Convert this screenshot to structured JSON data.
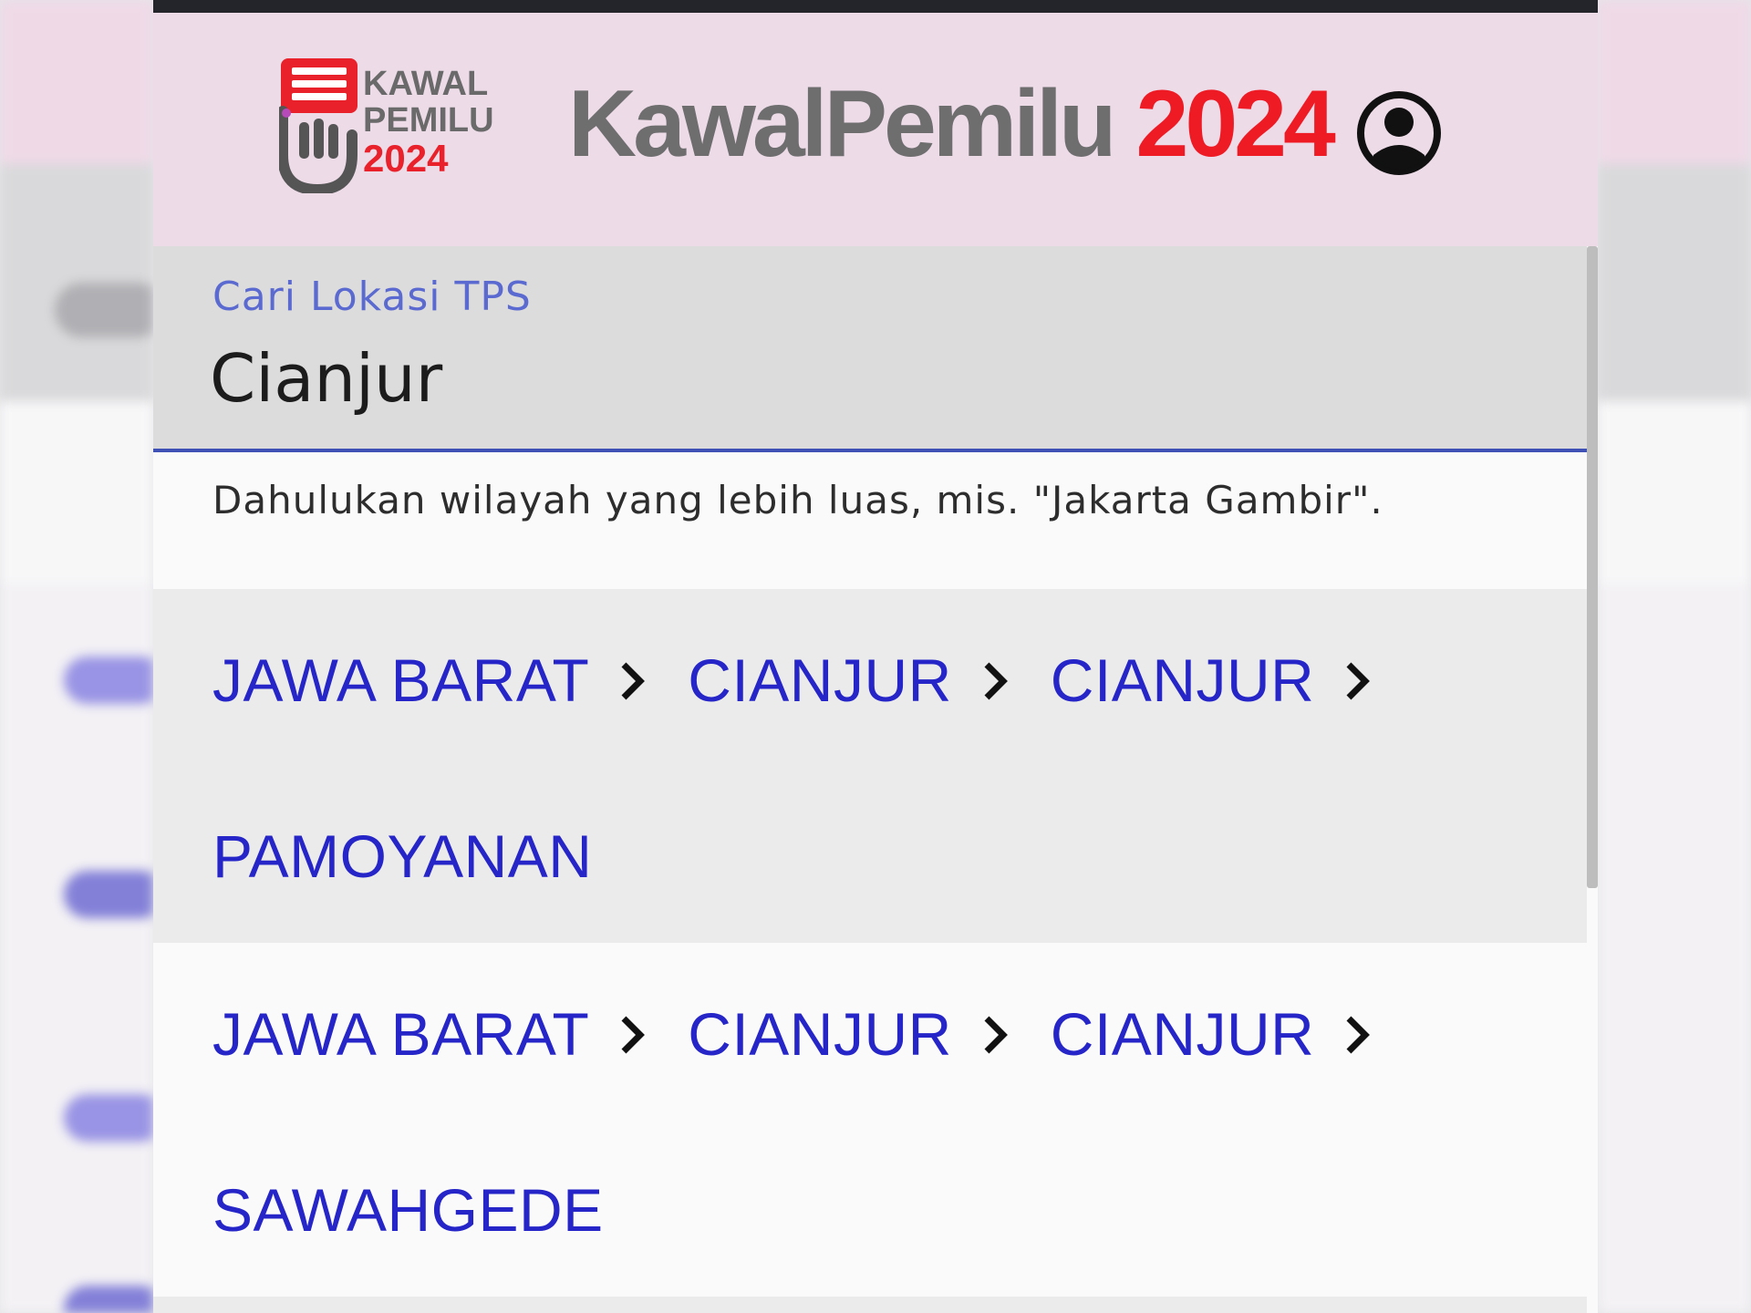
{
  "app": {
    "logo_text": [
      "KAWAL",
      "PEMILU",
      "2024"
    ],
    "title_main": "KawalPemilu",
    "title_year": "2024",
    "account_icon": "account-circle-icon"
  },
  "search": {
    "label": "Cari Lokasi TPS",
    "value": "Cianjur",
    "helper": "Dahulukan wilayah yang lebih luas, mis. \"Jakarta Gambir\"."
  },
  "results": [
    {
      "path": [
        "JAWA BARAT",
        "CIANJUR",
        "CIANJUR"
      ],
      "last": "PAMOYANAN"
    },
    {
      "path": [
        "JAWA BARAT",
        "CIANJUR",
        "CIANJUR"
      ],
      "last": "SAWAHGEDE"
    }
  ],
  "colors": {
    "appbar": "#eddbe8",
    "title_gray": "#6e6e6e",
    "title_red": "#ee1b25",
    "link_blue": "#2525c8",
    "focus_indigo": "#3f51b5"
  }
}
